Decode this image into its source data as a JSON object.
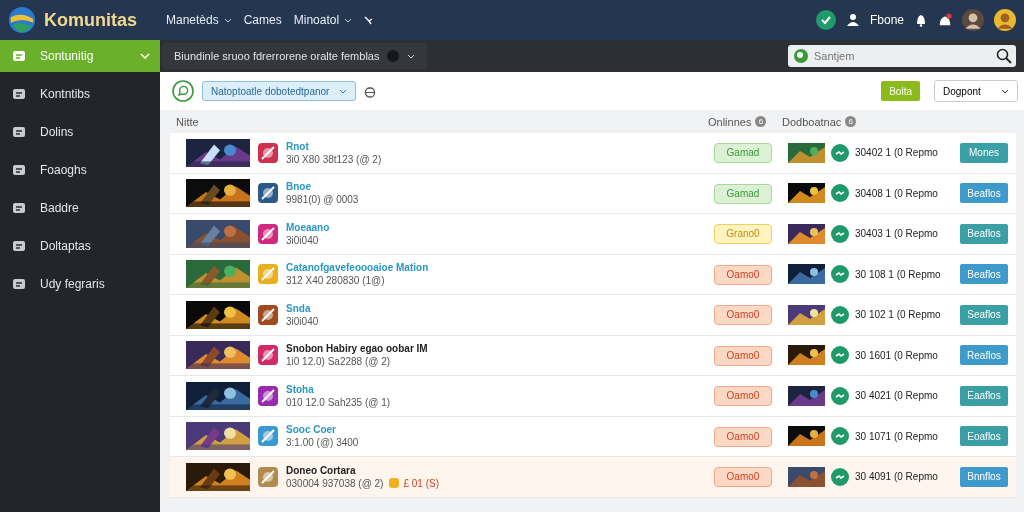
{
  "header": {
    "brand": "Komunitas",
    "nav": [
      {
        "label": "Manetèds",
        "dropdown": true
      },
      {
        "label": "Cames",
        "dropdown": false
      },
      {
        "label": "Minoatol",
        "dropdown": true
      }
    ],
    "user": "Fbone"
  },
  "sidebar": {
    "items": [
      {
        "label": "Sontunitig",
        "selected": true
      },
      {
        "label": "Kontntibs",
        "selected": false
      },
      {
        "label": "Dolins",
        "selected": false
      },
      {
        "label": "Foaoghs",
        "selected": false
      },
      {
        "label": "Baddre",
        "selected": false
      },
      {
        "label": "Doltaptas",
        "selected": false
      },
      {
        "label": "Udy fegraris",
        "selected": false
      }
    ]
  },
  "toolbar": {
    "scope": "Biundinle sruoo fdrerrorene oralte femblas",
    "search": {
      "placeholder": "Santjem"
    }
  },
  "filters": {
    "filter": "Natoptoatle dobotedtpanor",
    "apply": "Bolta",
    "sort": "Dogpont"
  },
  "table": {
    "columns": [
      {
        "label": "Nitte"
      },
      {
        "label": "Onlinnes",
        "count": "6"
      },
      {
        "label": "Dodboatnac",
        "count": "6"
      }
    ],
    "rows": [
      {
        "name": "Rnot",
        "linked": true,
        "meta": "3i0 X80 38t123 (@ 2)",
        "status": "Gamad",
        "kind": "ok",
        "detail": "30402 1 (0 Repmo",
        "action": "Mones",
        "color": "#3aa0a6",
        "selected": false
      },
      {
        "name": "Bnoe",
        "linked": true,
        "meta": "9981(0) @ 0003",
        "status": "Gamad",
        "kind": "ok",
        "detail": "30408 1 (0 Repmo",
        "action": "Beaflos",
        "color": "#3d9acb",
        "selected": false
      },
      {
        "name": "Moeaano",
        "linked": true,
        "meta": "3i0i040",
        "status": "Grano0",
        "kind": "warn",
        "detail": "30403 1 (0 Repmo",
        "action": "Beaflos",
        "color": "#3aa0a6",
        "selected": false
      },
      {
        "name": "Catanofgavefeoooaioe Mation",
        "linked": true,
        "meta": "312 X40 280830 (1@)",
        "status": "Oamo0",
        "kind": "late",
        "detail": "30 108 1 (0 Repmo",
        "action": "Beaflos",
        "color": "#3d9acb",
        "selected": false
      },
      {
        "name": "Snda",
        "linked": true,
        "meta": "3i0i040",
        "status": "Oamo0",
        "kind": "late",
        "detail": "30 102 1 (0 Repmo",
        "action": "Seaflos",
        "color": "#3aa0a6",
        "selected": false
      },
      {
        "name": "Snobon Habiry egao oobar IM",
        "linked": false,
        "meta": "1i0 12.0) Sa2288 (@ 2)",
        "status": "Oamo0",
        "kind": "late",
        "detail": "30 1601 (0 Repmo",
        "action": "Reaflos",
        "color": "#3d9acb",
        "selected": false
      },
      {
        "name": "Stoha",
        "linked": true,
        "meta": "010 12.0 Sah235 (@ 1)",
        "status": "Oamo0",
        "kind": "late",
        "detail": "30 4021 (0 Repmo",
        "action": "Eaaflos",
        "color": "#3aa0a6",
        "selected": false
      },
      {
        "name": "Sooc Coer",
        "linked": true,
        "meta": "3:1.00 (@) 3400",
        "status": "Oamo0",
        "kind": "late",
        "detail": "30 1071 (0 Repmo",
        "action": "Eoaflos",
        "color": "#3aa0a6",
        "selected": false
      },
      {
        "name": "Doneo Cortara",
        "linked": false,
        "meta": "030004 937038 (@ 2)",
        "badge": "£ 01 (S)",
        "status": "Oamo0",
        "kind": "late",
        "detail": "30 4091 (0 Repmo",
        "action": "Bnnflos",
        "color": "#3d9acb",
        "selected": true
      }
    ]
  }
}
